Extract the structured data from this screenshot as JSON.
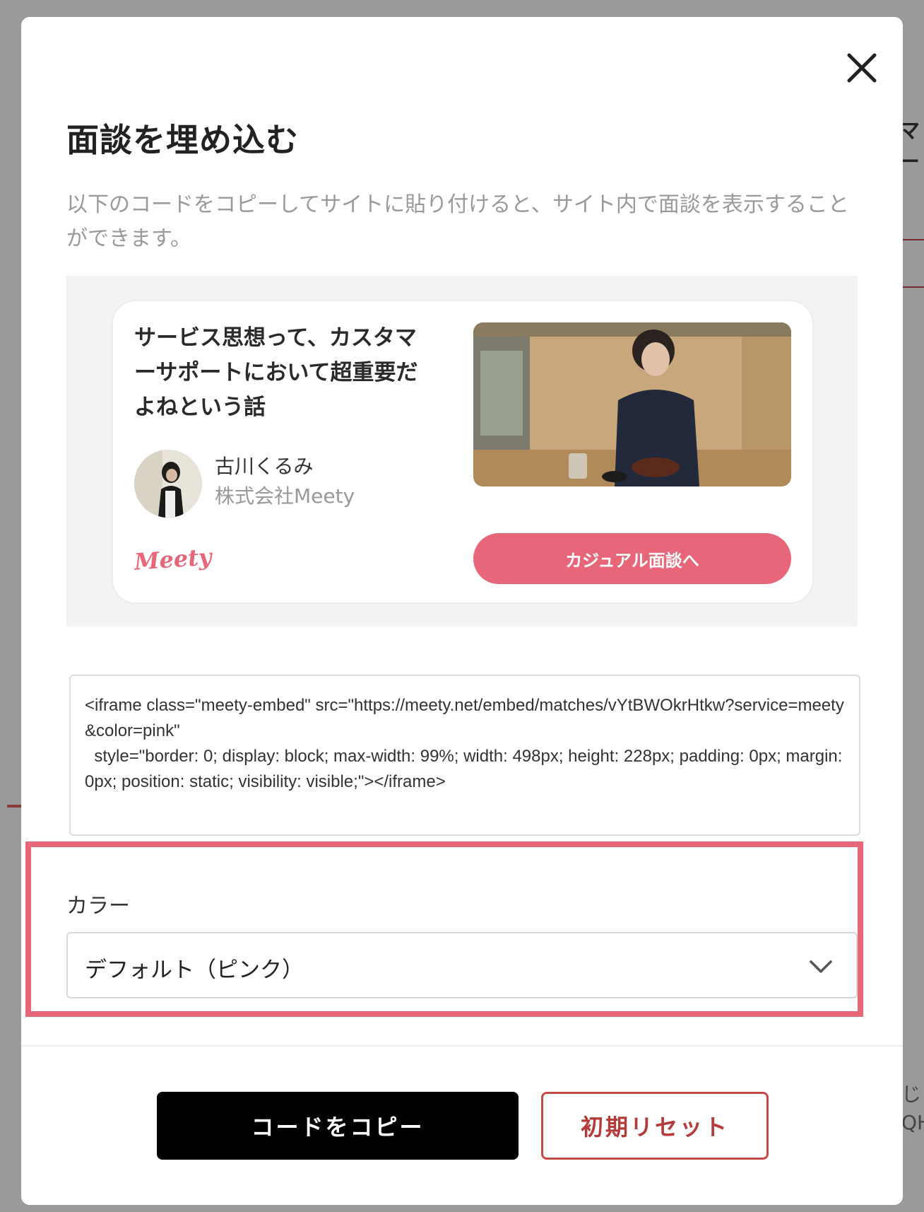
{
  "background": {
    "right_heading_fragment": "マー",
    "right_small_lines": [
      "じ",
      "QH"
    ]
  },
  "modal": {
    "title": "面談を埋め込む",
    "description": "以下のコードをコピーしてサイトに貼り付けると、サイト内で面談を表示することができます。",
    "close_icon": "close-icon"
  },
  "preview": {
    "card_title": "サービス思想って、カスタマーサポートにおいて超重要だよねという話",
    "author_name": "古川くるみ",
    "author_company": "株式会社Meety",
    "logo_text": "Meety",
    "cta_label": "カジュアル面談へ"
  },
  "embed_code": "<iframe class=\"meety-embed\" src=\"https://meety.net/embed/matches/vYtBWOkrHtkw?service=meety&color=pink\"\n  style=\"border: 0; display: block; max-width: 99%; width: 498px; height: 228px; padding: 0px; margin: 0px; position: static; visibility: visible;\"></iframe>",
  "color_setting": {
    "label": "カラー",
    "selected": "デフォルト（ピンク）",
    "icon": "chevron-down-icon"
  },
  "actions": {
    "copy_label": "コードをコピー",
    "reset_label": "初期リセット"
  },
  "colors": {
    "accent_pink": "#e8667a",
    "reset_red": "#c44a4a"
  }
}
